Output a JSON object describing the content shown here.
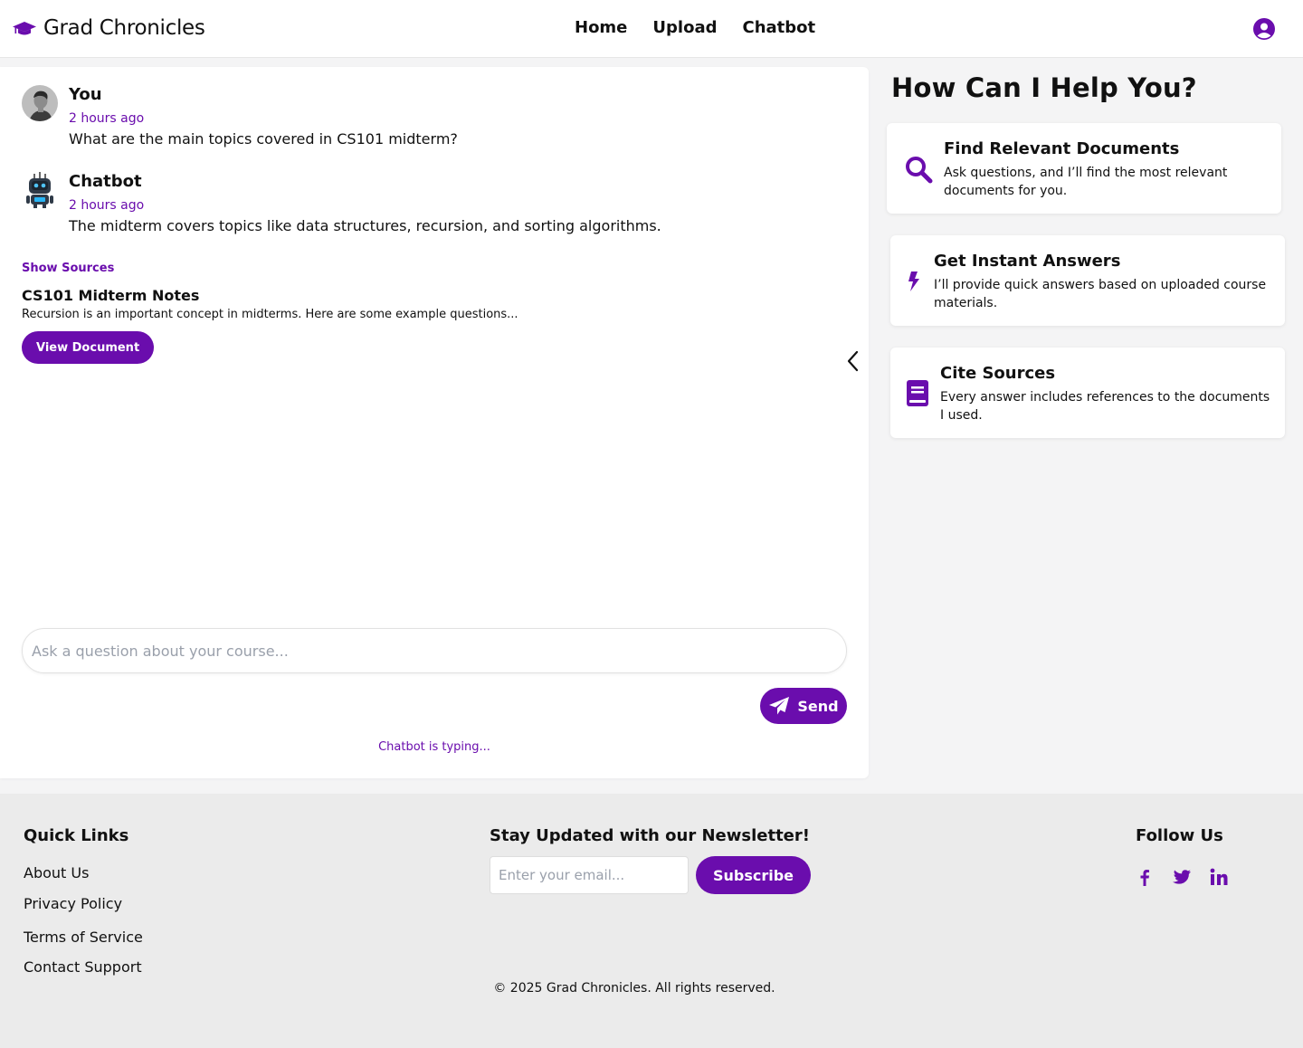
{
  "header": {
    "brand": "Grad Chronicles",
    "nav": [
      "Home",
      "Upload",
      "Chatbot"
    ]
  },
  "chat": {
    "messages": [
      {
        "author": "You",
        "time": "2 hours ago",
        "text": "What are the main topics covered in CS101 midterm?"
      },
      {
        "author": "Chatbot",
        "time": "2 hours ago",
        "text": "The midterm covers topics like data structures, recursion, and sorting algorithms."
      }
    ],
    "show_sources": "Show Sources",
    "source": {
      "title": "CS101 Midterm Notes",
      "snippet": "Recursion is an important concept in midterms. Here are some example questions...",
      "button": "View Document"
    },
    "input_placeholder": "Ask a question about your course...",
    "send_label": "Send",
    "typing": "Chatbot is typing..."
  },
  "help": {
    "title": "How Can I Help You?",
    "cards": [
      {
        "icon": "search-icon",
        "title": "Find Relevant Documents",
        "desc": "Ask questions, and I’ll find the most relevant documents for you."
      },
      {
        "icon": "bolt-icon",
        "title": "Get Instant Answers",
        "desc": "I’ll provide quick answers based on uploaded course materials."
      },
      {
        "icon": "book-icon",
        "title": "Cite Sources",
        "desc": "Every answer includes references to the documents I used."
      }
    ]
  },
  "footer": {
    "quick_links_title": "Quick Links",
    "quick_links": [
      "About Us",
      "Privacy Policy",
      "Terms of Service",
      "Contact Support"
    ],
    "newsletter_title": "Stay Updated with our Newsletter!",
    "newsletter_placeholder": "Enter your email...",
    "subscribe_label": "Subscribe",
    "follow_title": "Follow Us",
    "social": [
      "facebook-icon",
      "twitter-icon",
      "linkedin-icon"
    ],
    "copyright": "© 2025 Grad Chronicles. All rights reserved."
  },
  "colors": {
    "accent": "#6a0dad",
    "page_bg": "#f4f4f5",
    "footer_bg": "#ebebeb"
  }
}
